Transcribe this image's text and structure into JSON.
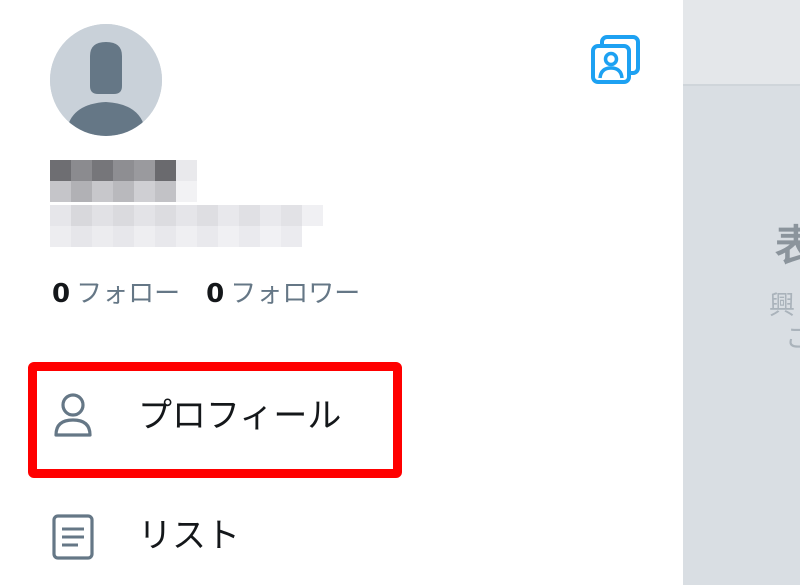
{
  "profile": {
    "following_count": "0",
    "following_label": "フォロー",
    "followers_count": "0",
    "followers_label": "フォロワー"
  },
  "menu": {
    "items": [
      {
        "label": "プロフィール",
        "icon": "person-icon",
        "highlighted": true
      },
      {
        "label": "リスト",
        "icon": "list-icon",
        "highlighted": false
      }
    ]
  },
  "background_panel": {
    "title_fragment": "表",
    "text_fragment_1": "興",
    "text_fragment_2": "こ"
  },
  "colors": {
    "accent": "#1da1f2",
    "text_primary": "#14171a",
    "text_secondary": "#657786",
    "highlight": "#ff0000",
    "avatar_bg": "#c9d1d9",
    "avatar_fg": "#657786"
  }
}
